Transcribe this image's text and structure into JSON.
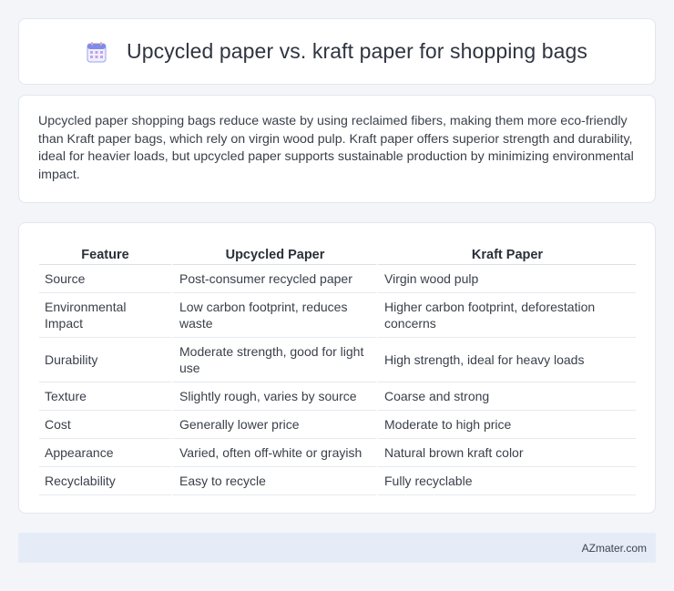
{
  "header": {
    "title": "Upcycled paper vs. kraft paper for shopping bags",
    "icon": "calendar-icon"
  },
  "summary": {
    "text": "Upcycled paper shopping bags reduce waste by using reclaimed fibers, making them more eco-friendly than Kraft paper bags, which rely on virgin wood pulp. Kraft paper offers superior strength and durability, ideal for heavier loads, but upcycled paper supports sustainable production by minimizing environmental impact."
  },
  "table": {
    "headers": [
      "Feature",
      "Upcycled Paper",
      "Kraft Paper"
    ],
    "rows": [
      [
        "Source",
        "Post-consumer recycled paper",
        "Virgin wood pulp"
      ],
      [
        "Environmental Impact",
        "Low carbon footprint, reduces waste",
        "Higher carbon footprint, deforestation concerns"
      ],
      [
        "Durability",
        "Moderate strength, good for light use",
        "High strength, ideal for heavy loads"
      ],
      [
        "Texture",
        "Slightly rough, varies by source",
        "Coarse and strong"
      ],
      [
        "Cost",
        "Generally lower price",
        "Moderate to high price"
      ],
      [
        "Appearance",
        "Varied, often off-white or grayish",
        "Natural brown kraft color"
      ],
      [
        "Recyclability",
        "Easy to recycle",
        "Fully recyclable"
      ]
    ]
  },
  "footer": {
    "site": "AZmater.com"
  }
}
